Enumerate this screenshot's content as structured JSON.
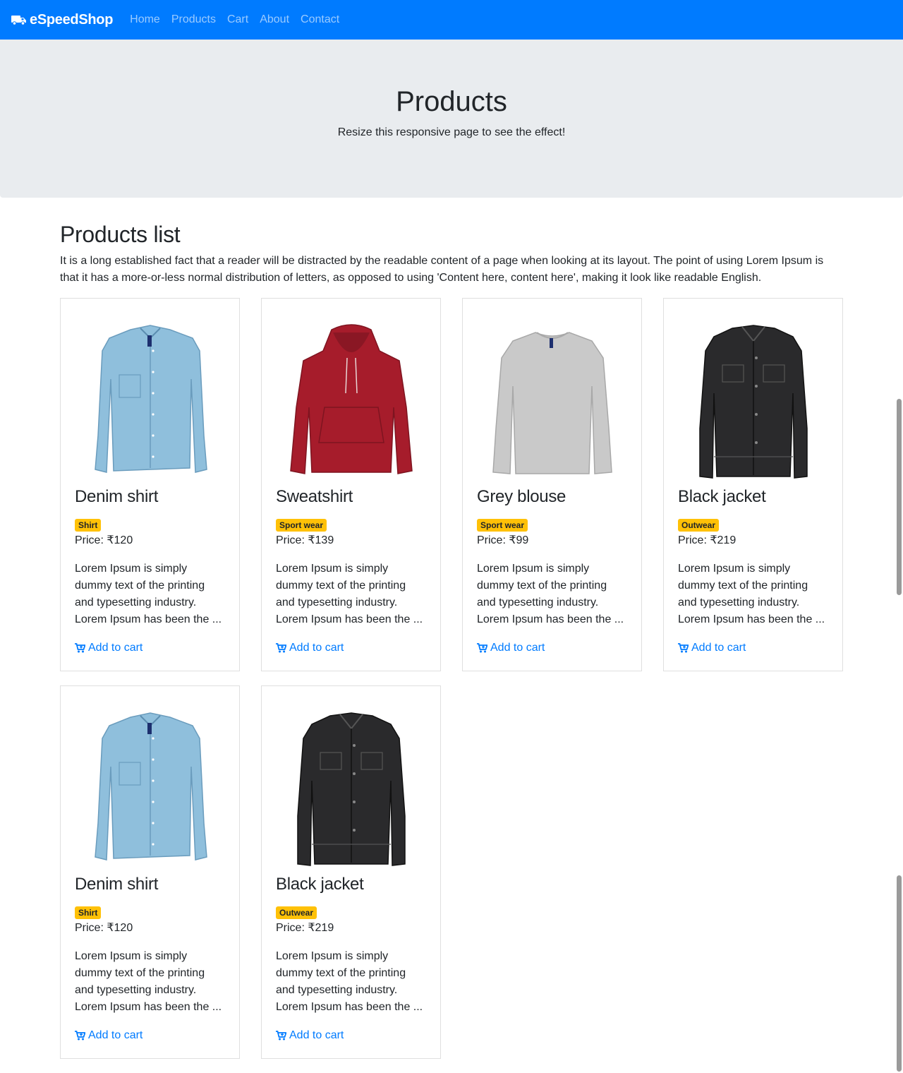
{
  "navbar": {
    "brand": "eSpeedShop",
    "links": [
      "Home",
      "Products",
      "Cart",
      "About",
      "Contact"
    ]
  },
  "jumbotron": {
    "title": "Products",
    "subtitle": "Resize this responsive page to see the effect!"
  },
  "main": {
    "heading": "Products list",
    "intro": "It is a long established fact that a reader will be distracted by the readable content of a page when looking at its layout. The point of using Lorem Ipsum is that it has a more-or-less normal distribution of letters, as opposed to using 'Content here, content here', making it look like readable English."
  },
  "products": [
    {
      "name": "Denim shirt",
      "category": "Shirt",
      "price": "Price: ₹120",
      "description": "Lorem Ipsum is simply dummy text of the printing and typesetting industry. Lorem Ipsum has been the ...",
      "action": "Add to cart",
      "image": "denim-shirt"
    },
    {
      "name": "Sweatshirt",
      "category": "Sport wear",
      "price": "Price: ₹139",
      "description": "Lorem Ipsum is simply dummy text of the printing and typesetting industry. Lorem Ipsum has been the ...",
      "action": "Add to cart",
      "image": "red-hoodie"
    },
    {
      "name": "Grey blouse",
      "category": "Sport wear",
      "price": "Price: ₹99",
      "description": "Lorem Ipsum is simply dummy text of the printing and typesetting industry. Lorem Ipsum has been the ...",
      "action": "Add to cart",
      "image": "grey-sweater"
    },
    {
      "name": "Black jacket",
      "category": "Outwear",
      "price": "Price: ₹219",
      "description": "Lorem Ipsum is simply dummy text of the printing and typesetting industry. Lorem Ipsum has been the ...",
      "action": "Add to cart",
      "image": "black-jacket"
    },
    {
      "name": "Denim shirt",
      "category": "Shirt",
      "price": "Price: ₹120",
      "description": "Lorem Ipsum is simply dummy text of the printing and typesetting industry. Lorem Ipsum has been the ...",
      "action": "Add to cart",
      "image": "denim-shirt"
    },
    {
      "name": "Black jacket",
      "category": "Outwear",
      "price": "Price: ₹219",
      "description": "Lorem Ipsum is simply dummy text of the printing and typesetting industry. Lorem Ipsum has been the ...",
      "action": "Add to cart",
      "image": "black-jacket"
    }
  ],
  "colors": {
    "primary": "#007bff",
    "jumbotron": "#e9ecef",
    "badge": "#ffc107",
    "text": "#212529"
  }
}
